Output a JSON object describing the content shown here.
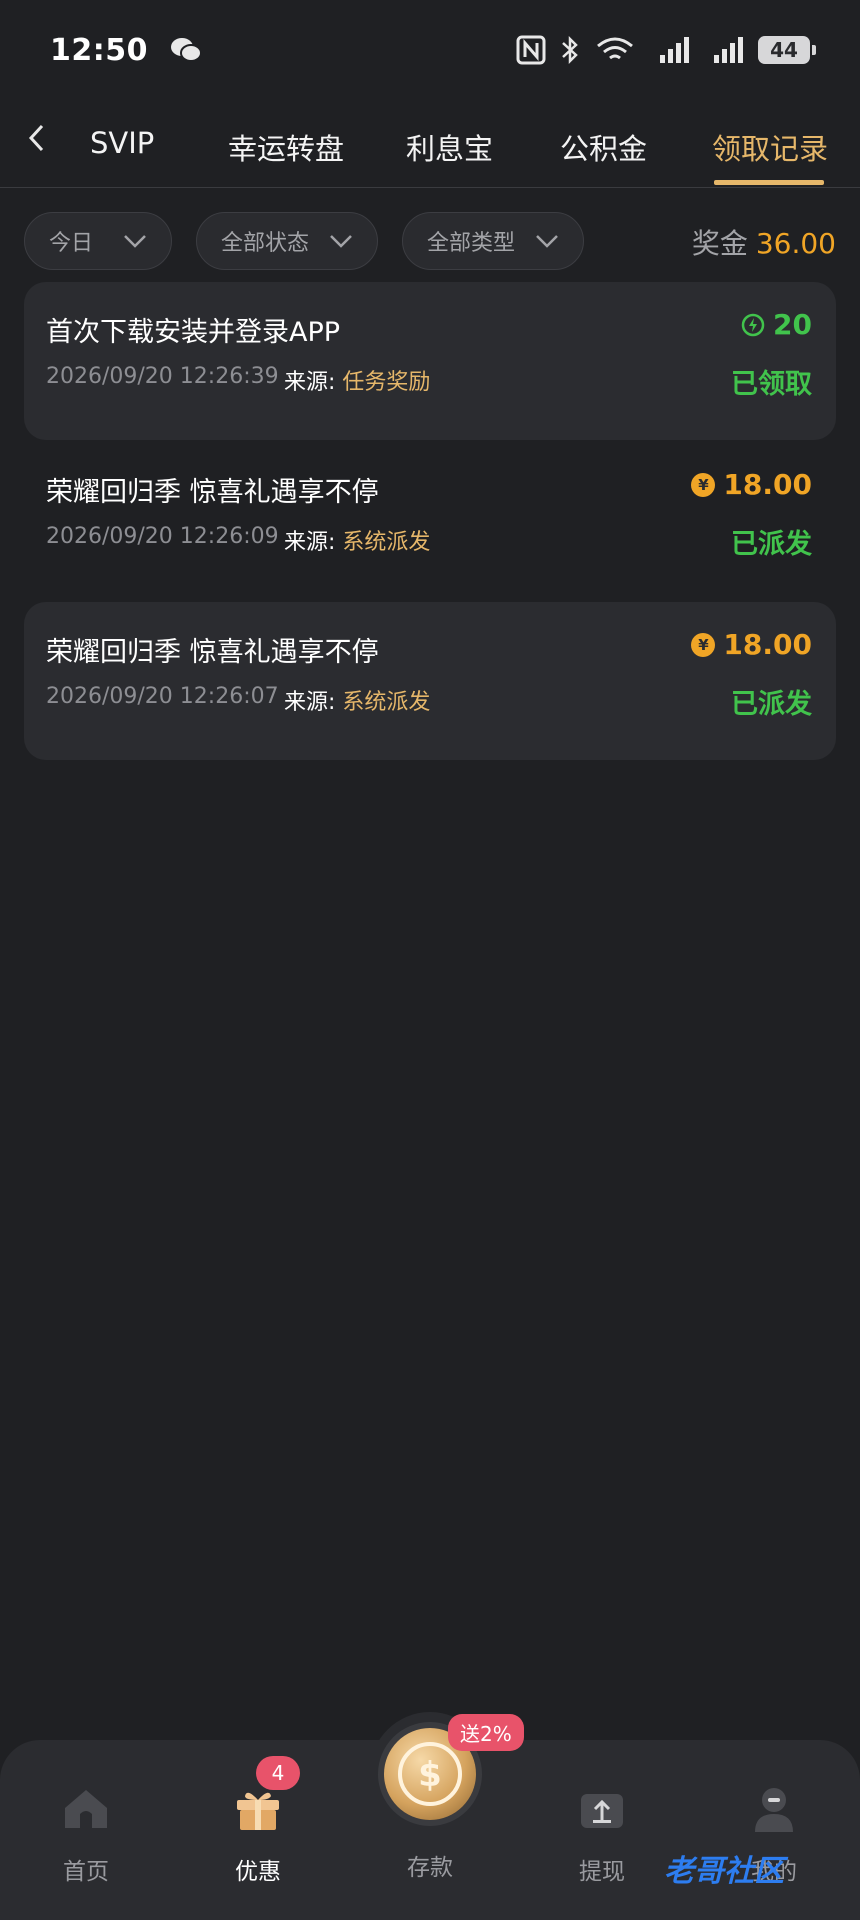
{
  "status": {
    "time": "12:50",
    "battery": "44"
  },
  "tabs": [
    {
      "label": "SVIP"
    },
    {
      "label": "幸运转盘"
    },
    {
      "label": "利息宝"
    },
    {
      "label": "公积金"
    },
    {
      "label": "领取记录"
    }
  ],
  "filters": {
    "date": "今日",
    "status": "全部状态",
    "type": "全部类型"
  },
  "bonus": {
    "label": "奖金",
    "amount": "36.00"
  },
  "source_label": "来源:",
  "records": [
    {
      "title": "首次下载安装并登录APP",
      "datetime": "2026/09/20 12:26:39",
      "source": "任务奖励",
      "amount": "20",
      "status": "已领取"
    },
    {
      "title": "荣耀回归季 惊喜礼遇享不停",
      "datetime": "2026/09/20 12:26:09",
      "source": "系统派发",
      "amount": "18.00",
      "status": "已派发"
    },
    {
      "title": "荣耀回归季 惊喜礼遇享不停",
      "datetime": "2026/09/20 12:26:07",
      "source": "系统派发",
      "amount": "18.00",
      "status": "已派发"
    }
  ],
  "nav": [
    {
      "label": "首页"
    },
    {
      "label": "优惠"
    },
    {
      "label": "存款"
    },
    {
      "label": "提现"
    },
    {
      "label": "我的"
    }
  ],
  "nav_badge": "4",
  "deposit_promo": "送2%",
  "watermark": "老哥社区",
  "coin_symbol": "¥",
  "colors": {
    "accent": "#e6b76a",
    "success": "#41c34c",
    "gold": "#f0a526",
    "badge": "#e8536a"
  }
}
